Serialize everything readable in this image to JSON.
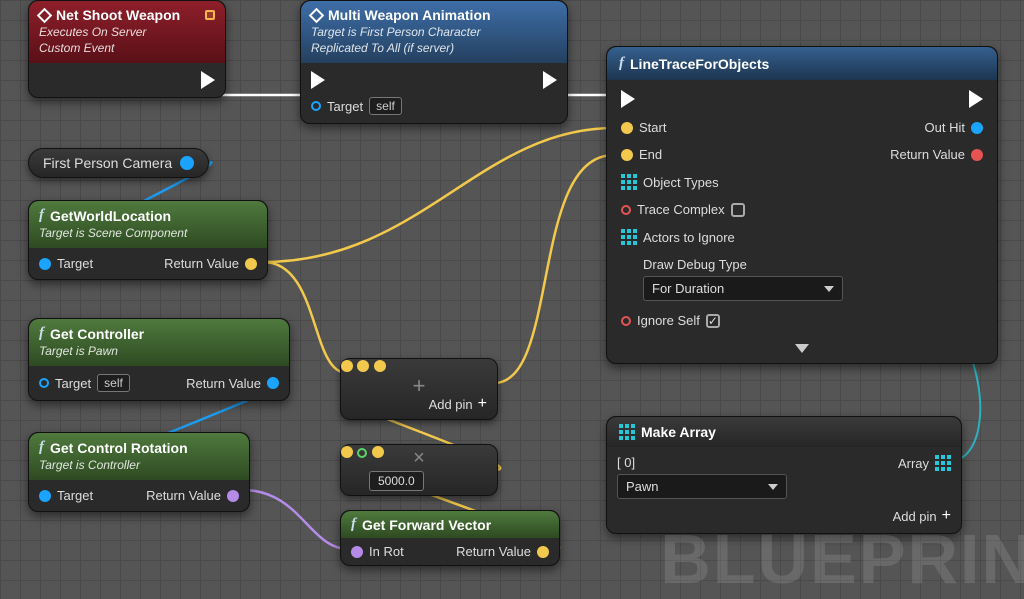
{
  "watermark": "BLUEPRIN",
  "nodes": {
    "netShoot": {
      "title": "Net Shoot Weapon",
      "sub1": "Executes On Server",
      "sub2": "Custom Event"
    },
    "multiWeapon": {
      "title": "Multi Weapon Animation",
      "sub1": "Target is First Person Character",
      "sub2": "Replicated To All (if server)",
      "targetLabel": "Target",
      "targetValue": "self"
    },
    "camera": {
      "label": "First Person Camera"
    },
    "getWorldLoc": {
      "title": "GetWorldLocation",
      "sub": "Target is Scene Component",
      "targetLabel": "Target",
      "returnLabel": "Return Value"
    },
    "getController": {
      "title": "Get Controller",
      "sub": "Target is Pawn",
      "targetLabel": "Target",
      "targetValue": "self",
      "returnLabel": "Return Value"
    },
    "getControlRot": {
      "title": "Get Control Rotation",
      "sub": "Target is Controller",
      "targetLabel": "Target",
      "returnLabel": "Return Value"
    },
    "addNode": {
      "addPinLabel": "Add pin"
    },
    "mulNode": {
      "value": "5000.0"
    },
    "getForward": {
      "title": "Get Forward Vector",
      "inLabel": "In Rot",
      "returnLabel": "Return Value"
    },
    "lineTrace": {
      "title": "LineTraceForObjects",
      "start": "Start",
      "end": "End",
      "objectTypes": "Object Types",
      "traceComplex": "Trace Complex",
      "actorsIgnore": "Actors to Ignore",
      "drawDebugLabel": "Draw Debug Type",
      "drawDebugValue": "For Duration",
      "ignoreSelf": "Ignore Self",
      "outHit": "Out Hit",
      "returnValue": "Return Value"
    },
    "makeArray": {
      "title": "Make Array",
      "indexLabel": "[ 0]",
      "indexValue": "Pawn",
      "arrayLabel": "Array",
      "addPin": "Add pin"
    }
  }
}
